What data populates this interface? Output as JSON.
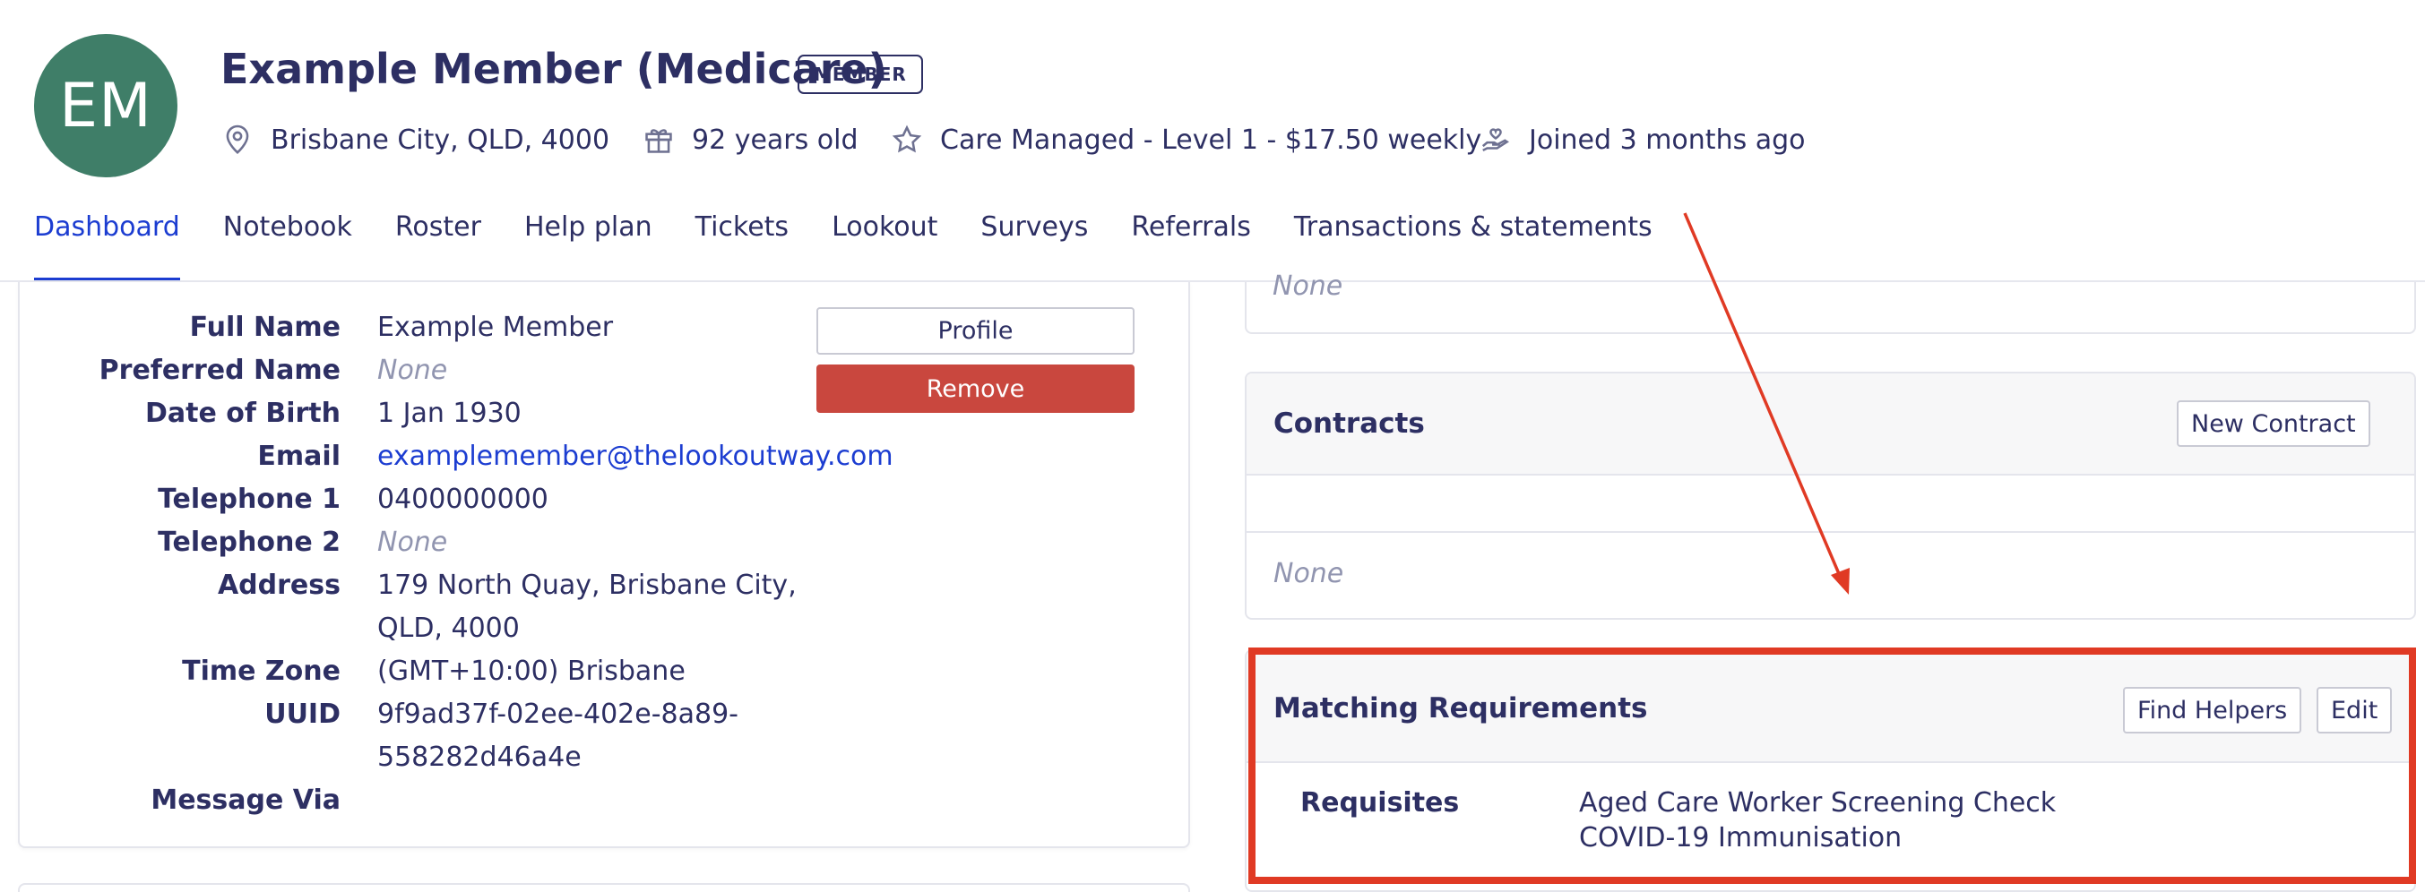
{
  "header": {
    "avatar_initials": "EM",
    "name": "Example Member (Medicare)",
    "badge": "MEMBER",
    "location": "Brisbane City, QLD, 4000",
    "age": "92 years old",
    "plan": "Care Managed - Level 1 - $17.50 weekly",
    "joined": "Joined 3 months ago"
  },
  "tabs": [
    {
      "label": "Dashboard",
      "active": true
    },
    {
      "label": "Notebook"
    },
    {
      "label": "Roster"
    },
    {
      "label": "Help plan"
    },
    {
      "label": "Tickets"
    },
    {
      "label": "Lookout"
    },
    {
      "label": "Surveys"
    },
    {
      "label": "Referrals"
    },
    {
      "label": "Transactions & statements"
    }
  ],
  "profile": {
    "labels": {
      "full_name": "Full Name",
      "preferred_name": "Preferred Name",
      "dob": "Date of Birth",
      "email": "Email",
      "tel1": "Telephone 1",
      "tel2": "Telephone 2",
      "address": "Address",
      "timezone": "Time Zone",
      "uuid": "UUID",
      "message_via": "Message Via"
    },
    "values": {
      "full_name": "Example Member",
      "preferred_name": "None",
      "dob": "1 Jan 1930",
      "email": "examplemember@thelookoutway.com",
      "tel1": "0400000000",
      "tel2": "None",
      "address_line1": "179 North Quay, Brisbane City,",
      "address_line2": "QLD, 4000",
      "timezone": "(GMT+10:00) Brisbane",
      "uuid_line1": "9f9ad37f-02ee-402e-8a89-",
      "uuid_line2": "558282d46a4e"
    },
    "profile_button": "Profile",
    "remove_button": "Remove"
  },
  "right_top": {
    "none_text": "None"
  },
  "contracts": {
    "title": "Contracts",
    "new_button": "New Contract",
    "none_text": "None"
  },
  "matching": {
    "title": "Matching Requirements",
    "find_helpers_button": "Find Helpers",
    "edit_button": "Edit",
    "requisites_label": "Requisites",
    "requisites": [
      "Aged Care Worker Screening Check",
      "COVID-19 Immunisation"
    ]
  },
  "colors": {
    "accent": "#1c3dd1",
    "text": "#2d2f63",
    "avatar": "#3f7e68",
    "remove": "#c9473e",
    "annotation": "#e03a24"
  }
}
